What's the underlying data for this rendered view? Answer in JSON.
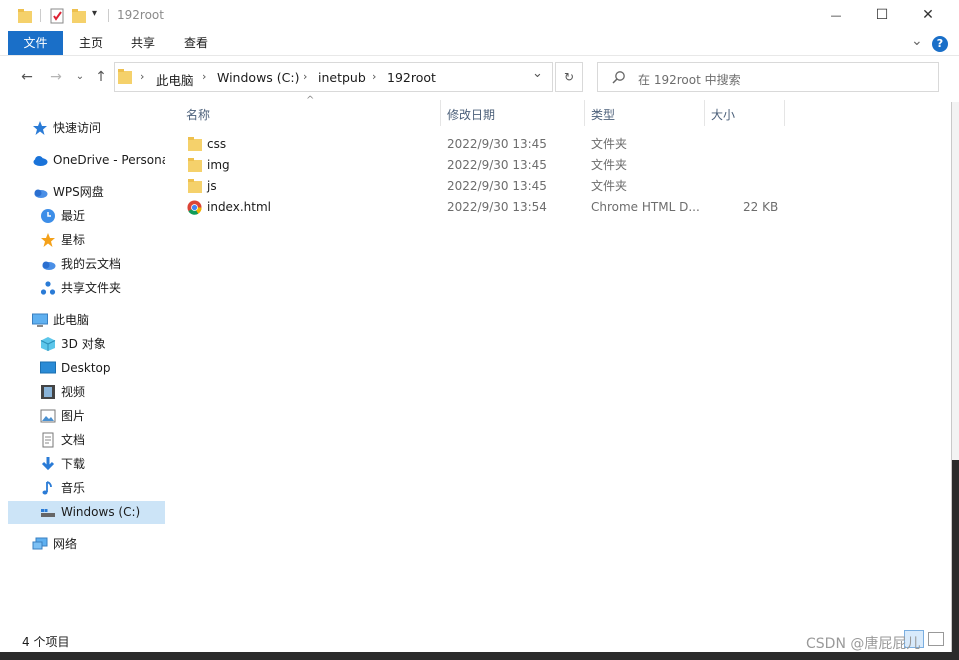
{
  "window": {
    "title": "192root",
    "minimize": "—",
    "maximize": "☐",
    "close": "✕"
  },
  "ribbon": {
    "tabs": [
      "文件",
      "主页",
      "共享",
      "查看"
    ],
    "expand": "⌄",
    "help": "?"
  },
  "address": {
    "crumbs": [
      "此电脑",
      "Windows (C:)",
      "inetpub",
      "192root"
    ],
    "dropdown": "⌄",
    "refresh": "↻"
  },
  "search": {
    "placeholder": "在 192root 中搜索"
  },
  "nav": {
    "quick_access": "快速访问",
    "onedrive": "OneDrive - Personal",
    "wps": "WPS网盘",
    "recent": "最近",
    "star": "星标",
    "mycloud": "我的云文档",
    "shared": "共享文件夹",
    "thispc": "此电脑",
    "obj3d": "3D 对象",
    "desktop": "Desktop",
    "videos": "视频",
    "pictures": "图片",
    "documents": "文档",
    "downloads": "下载",
    "music": "音乐",
    "cdrive": "Windows (C:)",
    "network": "网络"
  },
  "columns": {
    "name": "名称",
    "modified": "修改日期",
    "type": "类型",
    "size": "大小",
    "sort_arrow": "^"
  },
  "files": [
    {
      "name": "css",
      "modified": "2022/9/30 13:45",
      "type": "文件夹",
      "size": ""
    },
    {
      "name": "img",
      "modified": "2022/9/30 13:45",
      "type": "文件夹",
      "size": ""
    },
    {
      "name": "js",
      "modified": "2022/9/30 13:45",
      "type": "文件夹",
      "size": ""
    },
    {
      "name": "index.html",
      "modified": "2022/9/30 13:54",
      "type": "Chrome HTML D...",
      "size": "22 KB"
    }
  ],
  "status": {
    "count": "4 个项目"
  },
  "watermark": "CSDN @唐屁屁儿",
  "colors": {
    "accent": "#1a6fc8",
    "selection": "#cce4f7",
    "folder": "#f5d16b"
  }
}
